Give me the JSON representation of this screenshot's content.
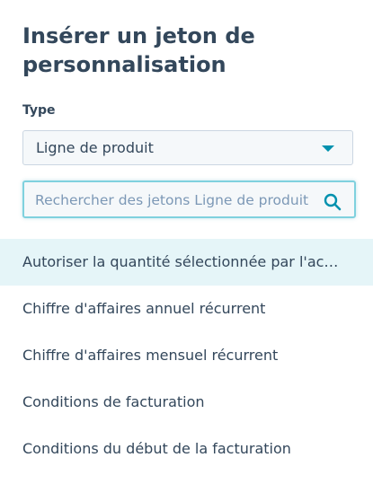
{
  "panel": {
    "title": "Insérer un jeton de personnalisation"
  },
  "type_field": {
    "label": "Type",
    "selected": "Ligne de produit",
    "caret_color": "#0091ae"
  },
  "search": {
    "value": "",
    "placeholder": "Rechercher des jetons Ligne de produit"
  },
  "tokens": [
    {
      "label": "Autoriser la quantité sélectionnée par l'ac…"
    },
    {
      "label": "Chiffre d'affaires annuel récurrent"
    },
    {
      "label": "Chiffre d'affaires mensuel récurrent"
    },
    {
      "label": "Conditions de facturation"
    },
    {
      "label": "Conditions du début de la facturation"
    }
  ],
  "colors": {
    "text": "#33475b",
    "accent": "#0091ae",
    "highlight": "#e5f5f8"
  }
}
